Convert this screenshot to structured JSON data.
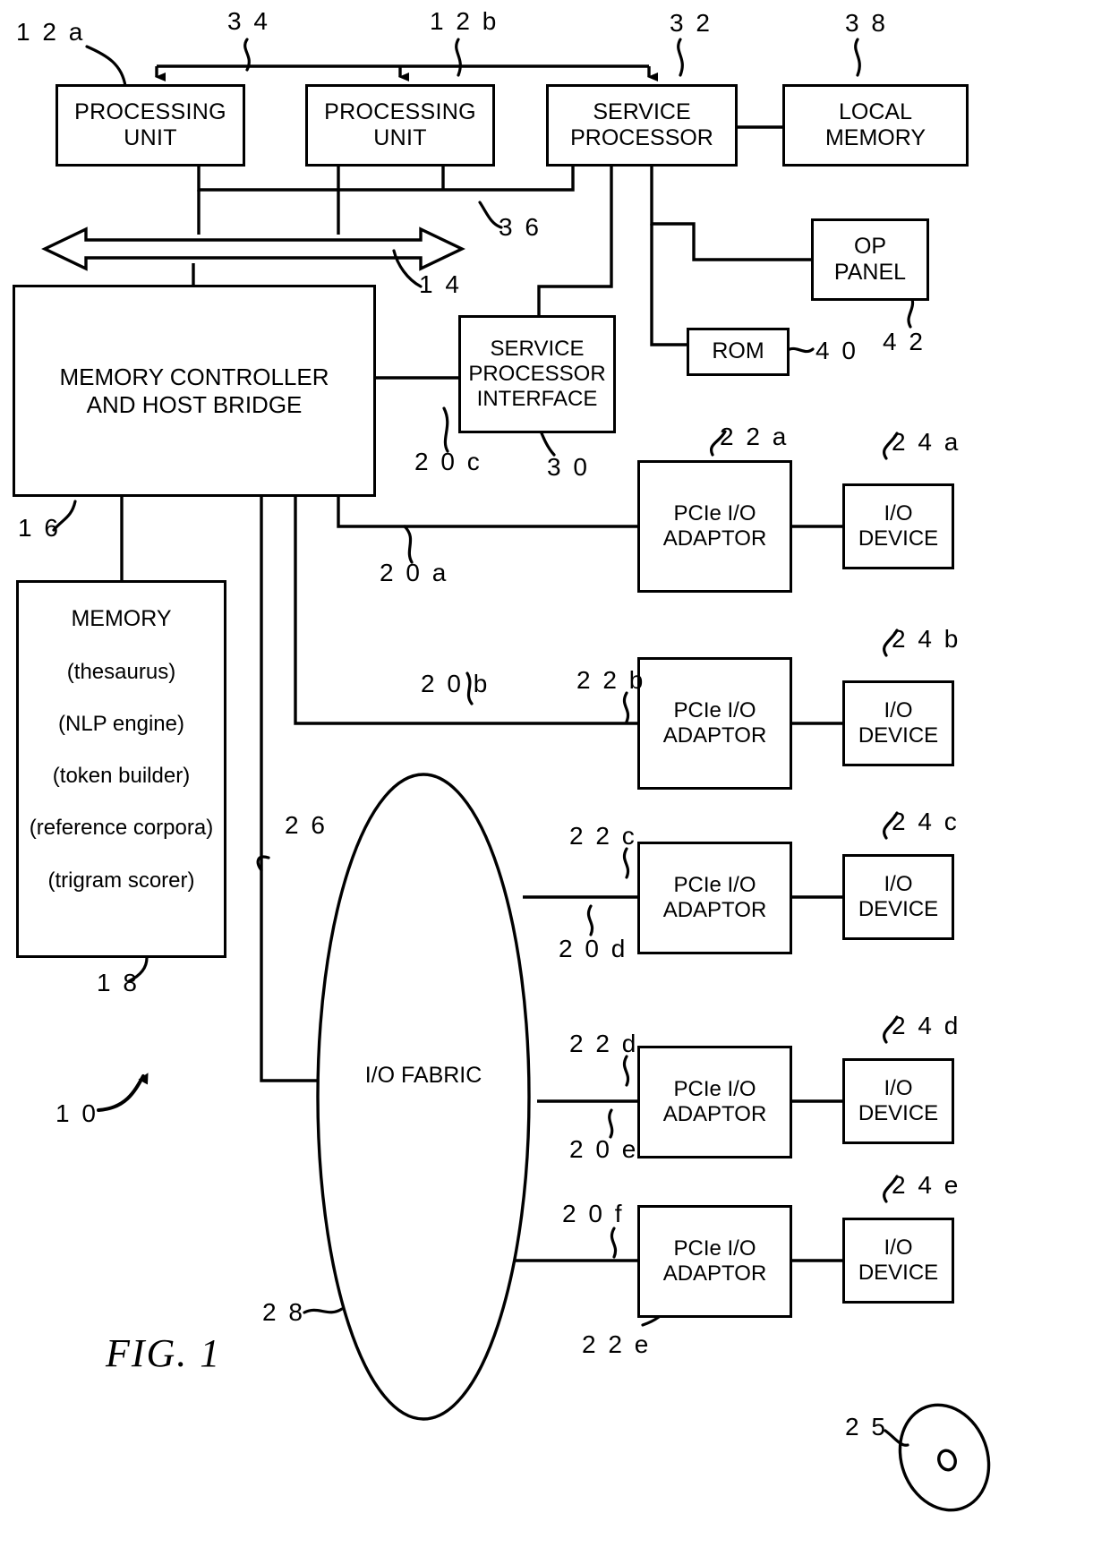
{
  "figure": {
    "label": "FIG. 1",
    "system_ref": "1 0"
  },
  "blocks": {
    "processing_unit_a": {
      "lines": [
        "PROCESSING",
        "UNIT"
      ],
      "ref": "1 2 a"
    },
    "processing_unit_b": {
      "lines": [
        "PROCESSING",
        "UNIT"
      ],
      "ref": "1 2 b"
    },
    "service_processor": {
      "lines": [
        "SERVICE",
        "PROCESSOR"
      ],
      "ref": "3 2"
    },
    "local_memory": {
      "lines": [
        "LOCAL",
        "MEMORY"
      ],
      "ref": "3 8"
    },
    "memory_controller": {
      "lines": [
        "MEMORY CONTROLLER",
        "AND HOST BRIDGE"
      ],
      "ref": "1 6"
    },
    "service_processor_interface": {
      "lines": [
        "SERVICE",
        "PROCESSOR",
        "INTERFACE"
      ],
      "ref": "3 0"
    },
    "rom": {
      "lines": [
        "ROM"
      ],
      "ref": "4 0"
    },
    "op_panel": {
      "lines": [
        "OP",
        "PANEL"
      ],
      "ref": "4 2"
    },
    "memory": {
      "title": "MEMORY",
      "items": [
        "(thesaurus)",
        "(NLP engine)",
        "(token builder)",
        "(reference corpora)",
        "(trigram scorer)"
      ],
      "ref": "1 8"
    },
    "io_fabric": {
      "lines": [
        "I/O",
        "FABRIC"
      ],
      "ref": "2 8"
    },
    "mouse_device": {
      "ref": "2 5"
    }
  },
  "adaptors": [
    {
      "lines": [
        "PCIe I/O",
        "ADAPTOR"
      ],
      "ref": "2 2 a",
      "bus_ref": "2 0 a",
      "device": {
        "lines": [
          "I/O",
          "DEVICE"
        ],
        "ref": "2 4 a"
      }
    },
    {
      "lines": [
        "PCIe I/O",
        "ADAPTOR"
      ],
      "ref": "2 2 b",
      "bus_ref": "2 0 b",
      "device": {
        "lines": [
          "I/O",
          "DEVICE"
        ],
        "ref": "2 4 b"
      }
    },
    {
      "lines": [
        "PCIe I/O",
        "ADAPTOR"
      ],
      "ref": "2 2 c",
      "bus_ref": "2 0 d",
      "device": {
        "lines": [
          "I/O",
          "DEVICE"
        ],
        "ref": "2 4 c"
      }
    },
    {
      "lines": [
        "PCIe I/O",
        "ADAPTOR"
      ],
      "ref": "2 2 d",
      "bus_ref": "2 0 e",
      "device": {
        "lines": [
          "I/O",
          "DEVICE"
        ],
        "ref": "2 4 d"
      }
    },
    {
      "lines": [
        "PCIe I/O",
        "ADAPTOR"
      ],
      "ref": "2 2 e",
      "bus_ref": "2 0 f",
      "device": {
        "lines": [
          "I/O",
          "DEVICE"
        ],
        "ref": "2 4 e"
      }
    }
  ],
  "connection_refs": {
    "interrupt_bus": "3 4",
    "service_bus": "3 6",
    "system_bus": "1 4",
    "spi_bus": "2 0 c",
    "fabric_bus": "2 6"
  },
  "colors": {
    "ink": "#000000",
    "paper": "#ffffff"
  }
}
